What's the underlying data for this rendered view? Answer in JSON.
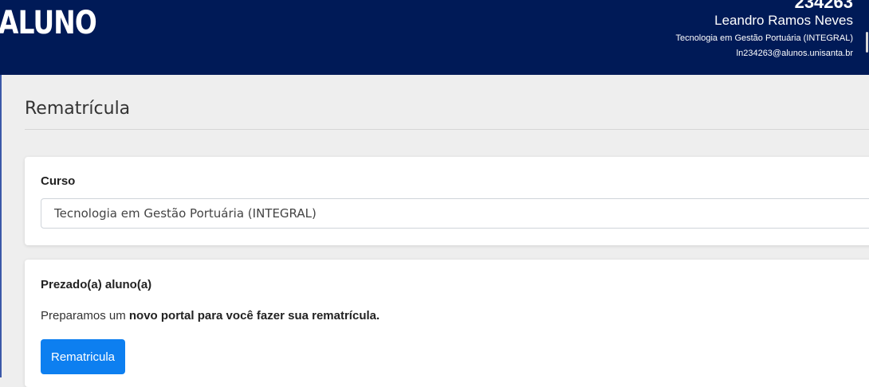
{
  "header": {
    "brand": "ALUNO",
    "user_id": "234263",
    "user_name": "Leandro Ramos Neves",
    "user_course": "Tecnologia em Gestão Portuária (INTEGRAL)",
    "user_email": "ln234263@alunos.unisanta.br"
  },
  "page": {
    "title": "Rematrícula"
  },
  "course_card": {
    "label": "Curso",
    "selected_value": "Tecnologia em Gestão Portuária (INTEGRAL)"
  },
  "notice_card": {
    "greeting": "Prezado(a) aluno(a)",
    "message_prefix": "Preparamos um ",
    "message_bold": "novo portal para você fazer sua rematrícula.",
    "button_label": "Rematricula"
  },
  "colors": {
    "header_bg": "#001a57",
    "button_bg": "#0d7ff0"
  }
}
